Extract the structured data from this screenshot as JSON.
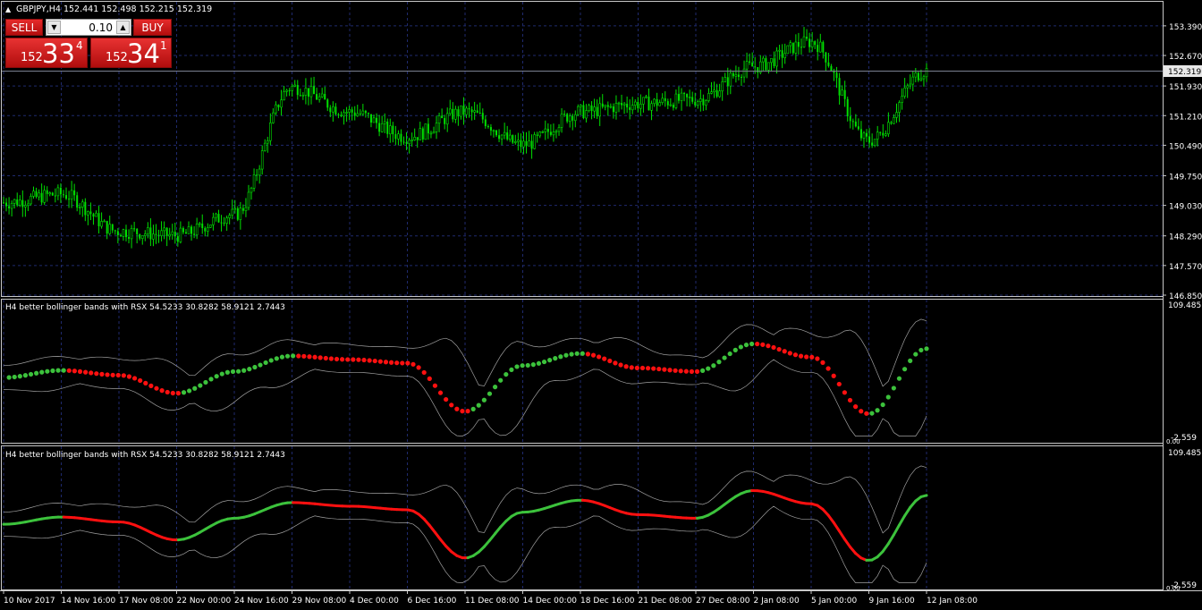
{
  "main_chart": {
    "symbol_info": "GBPJPY,H4  152.441 152.498 152.215 152.319",
    "current_price": "152.319",
    "price_ticks": [
      "153.390",
      "152.670",
      "151.930",
      "151.210",
      "150.490",
      "149.750",
      "149.030",
      "148.290",
      "147.570",
      "146.850"
    ]
  },
  "trade_panel": {
    "sell_label": "SELL",
    "buy_label": "BUY",
    "lot_value": "0.10",
    "sell_price": {
      "small": "152",
      "big": "33",
      "sup": "4"
    },
    "buy_price": {
      "small": "152",
      "big": "34",
      "sup": "1"
    }
  },
  "indicator_1": {
    "title": "H4 better bollinger bands with RSX 54.5233 30.8282 58.9121 2.7443",
    "y_top": "109.485",
    "y_bottom": "-2.559",
    "y_zero": "0.00"
  },
  "indicator_2": {
    "title": "H4 better bollinger bands with RSX 54.5233 30.8282 58.9121 2.7443",
    "y_top": "109.485",
    "y_bottom": "-2.559",
    "y_zero": "0.00"
  },
  "time_axis": [
    "10 Nov 2017",
    "14 Nov 16:00",
    "17 Nov 08:00",
    "22 Nov 00:00",
    "24 Nov 16:00",
    "29 Nov 08:00",
    "4 Dec 00:00",
    "6 Dec 16:00",
    "11 Dec 08:00",
    "14 Dec 00:00",
    "18 Dec 16:00",
    "21 Dec 08:00",
    "27 Dec 08:00",
    "2 Jan 08:00",
    "5 Jan 00:00",
    "9 Jan 16:00",
    "12 Jan 08:00"
  ],
  "chart_data": [
    {
      "type": "line",
      "title": "GBPJPY,H4",
      "x": [
        "10 Nov 2017",
        "14 Nov 16:00",
        "17 Nov 08:00",
        "22 Nov 00:00",
        "24 Nov 16:00",
        "29 Nov 08:00",
        "4 Dec 00:00",
        "6 Dec 16:00",
        "11 Dec 08:00",
        "14 Dec 00:00",
        "18 Dec 16:00",
        "21 Dec 08:00",
        "27 Dec 08:00",
        "2 Jan 08:00",
        "5 Jan 00:00",
        "9 Jan 16:00",
        "12 Jan 08:00"
      ],
      "series": [
        {
          "values": [
            149.1,
            149.3,
            148.4,
            148.3,
            148.8,
            151.9,
            151.3,
            150.7,
            151.3,
            150.5,
            151.3,
            151.5,
            151.6,
            152.4,
            153.0,
            150.6,
            152.3
          ]
        }
      ],
      "ylim": [
        146.85,
        153.8
      ],
      "colors": {
        "bars": "#00e000",
        "grid": "#1f2a6e"
      }
    },
    {
      "type": "line",
      "title": "H4 better bollinger bands with RSX 54.5233 30.8282 58.9121 2.7443",
      "x": [
        "10 Nov 2017",
        "14 Nov 16:00",
        "17 Nov 08:00",
        "22 Nov 00:00",
        "24 Nov 16:00",
        "29 Nov 08:00",
        "4 Dec 00:00",
        "6 Dec 16:00",
        "11 Dec 08:00",
        "14 Dec 00:00",
        "18 Dec 16:00",
        "21 Dec 08:00",
        "27 Dec 08:00",
        "2 Jan 08:00",
        "5 Jan 00:00",
        "9 Jan 16:00",
        "12 Jan 08:00"
      ],
      "series": [
        {
          "values": [
            50,
            56,
            52,
            37,
            55,
            68,
            65,
            62,
            22,
            60,
            70,
            58,
            55,
            78,
            67,
            20,
            74
          ]
        }
      ],
      "ylim": [
        -2.559,
        109.485
      ],
      "colors": {
        "up": "#3cc23c",
        "down": "#ff1010",
        "bands": "#a0a0a0"
      }
    }
  ]
}
